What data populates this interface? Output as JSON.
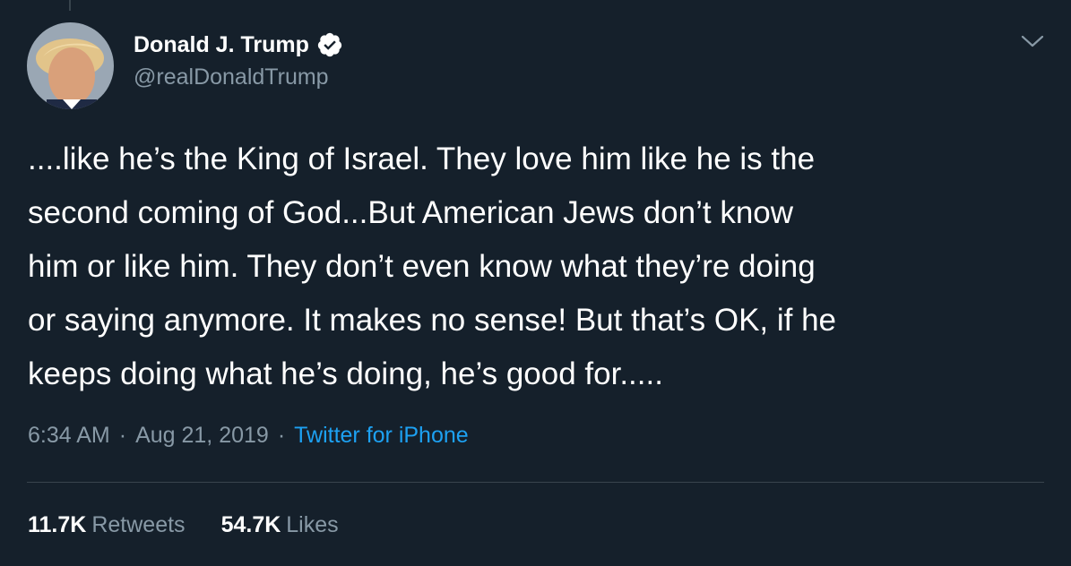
{
  "colors": {
    "background": "#15202b",
    "text_primary": "#ffffff",
    "text_secondary": "#8899a6",
    "accent": "#1da1f2",
    "divider": "#38444d"
  },
  "author": {
    "name": "Donald J. Trump",
    "handle": "@realDonaldTrump",
    "verified": true,
    "verified_icon": "verified-badge-icon",
    "avatar_icon": "avatar"
  },
  "menu_icon": "chevron-down-icon",
  "tweet": {
    "lines": [
      "....like he’s the King of Israel. They love him like he is the",
      "second coming of God...But American Jews don’t know",
      "him or like him. They don’t even know what they’re doing",
      "or saying anymore. It makes no sense! But that’s OK, if he",
      "keeps doing what he’s doing, he’s good for....."
    ]
  },
  "meta": {
    "time": "6:34 AM",
    "separator": "·",
    "date": "Aug 21, 2019",
    "source": "Twitter for iPhone"
  },
  "stats": {
    "retweets_count": "11.7K",
    "retweets_label": "Retweets",
    "likes_count": "54.7K",
    "likes_label": "Likes"
  }
}
